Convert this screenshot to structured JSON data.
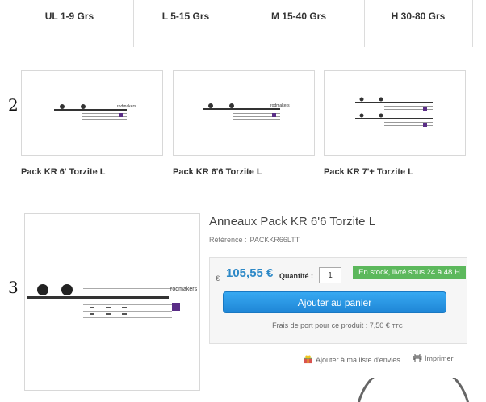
{
  "categories": [
    {
      "label": "UL 1-9 Grs"
    },
    {
      "label": "L 5-15 Grs"
    },
    {
      "label": "M 15-40 Grs"
    },
    {
      "label": "H 30-80 Grs"
    }
  ],
  "markers": {
    "first": "2",
    "second": "3"
  },
  "related_products": [
    {
      "name": "Pack KR 6' Torzite L"
    },
    {
      "name": "Pack KR 6'6 Torzite L"
    },
    {
      "name": "Pack KR 7'+ Torzite L"
    }
  ],
  "product": {
    "title": "Anneaux Pack KR 6'6 Torzite L",
    "reference_label": "Référence :",
    "reference_value": "PACKKR66LTT",
    "currency": "€",
    "price": "105,55 €",
    "quantity_label": "Quantité :",
    "quantity_value": "1",
    "stock_text": "En stock, livré sous 24 à 48 H",
    "cart_button": "Ajouter au panier",
    "shipping_text": "Frais de port pour ce produit : 7,50 €",
    "shipping_suffix": "TTC",
    "wishlist_label": "Ajouter à ma liste d'envies",
    "print_label": "Imprimer"
  },
  "image_brand": "rodmakers",
  "colors": {
    "price": "#2e89c7",
    "stock_badge": "#5cb85c",
    "cart_button": "#2a97e4",
    "brand_purple": "#5a2d86"
  },
  "icons": [
    "gift-icon",
    "printer-icon"
  ]
}
